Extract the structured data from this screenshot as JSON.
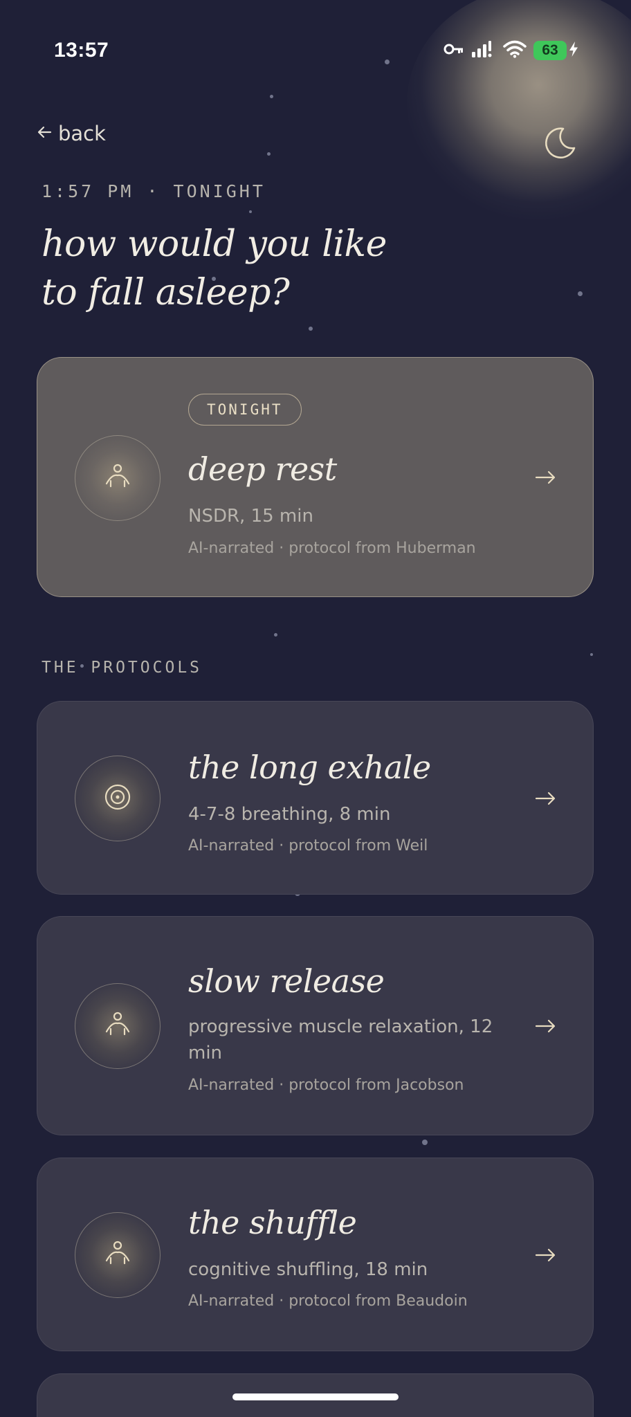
{
  "status_bar": {
    "time": "13:57",
    "battery": "63"
  },
  "header": {
    "back_label": "back",
    "eyebrow": "1:57 PM · TONIGHT",
    "title_line1": "how would you like",
    "title_line2": "to fall asleep?"
  },
  "featured": {
    "badge": "TONIGHT",
    "title": "deep rest",
    "subtitle": "NSDR, 15 min",
    "meta": "AI-narrated · protocol from Huberman",
    "icon": "person-icon"
  },
  "protocols": {
    "section_label": "THE PROTOCOLS",
    "items": [
      {
        "title": "the long exhale",
        "subtitle": "4-7-8 breathing, 8 min",
        "meta": "AI-narrated · protocol from Weil",
        "icon": "breath-circle-icon"
      },
      {
        "title": "slow release",
        "subtitle": "progressive muscle relaxation, 12 min",
        "meta": "AI-narrated · protocol from Jacobson",
        "icon": "person-icon"
      },
      {
        "title": "the shuffle",
        "subtitle": "cognitive shuffling, 18 min",
        "meta": "AI-narrated · protocol from Beaudoin",
        "icon": "person-icon"
      }
    ]
  },
  "colors": {
    "background": "#1f2037",
    "card": "#393849",
    "featured_card": "#5f5b5c",
    "accent": "#eadfc6",
    "battery": "#3fc75a"
  }
}
